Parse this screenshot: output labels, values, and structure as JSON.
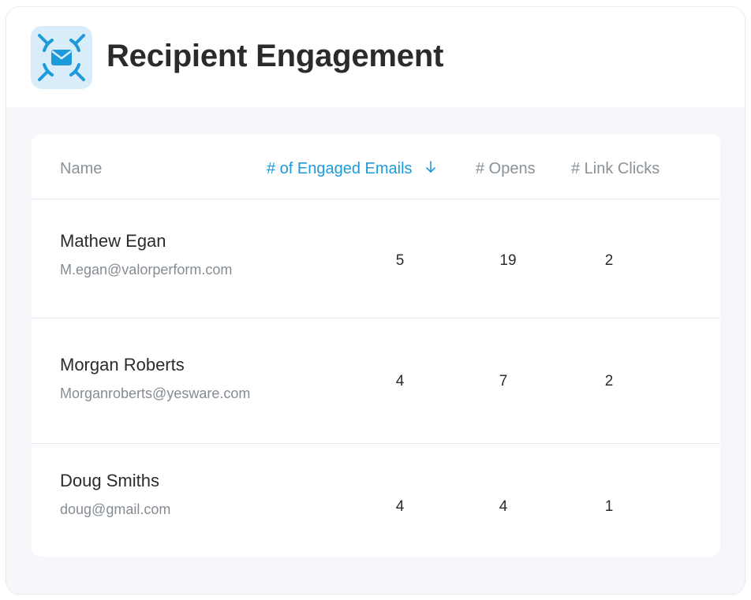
{
  "header": {
    "title": "Recipient Engagement",
    "logo_icon": "envelope-target-icon"
  },
  "table": {
    "columns": {
      "name": "Name",
      "engaged": "# of Engaged Emails",
      "opens": "# Opens",
      "clicks": "# Link Clicks"
    },
    "sort_icon": "arrow-down-icon",
    "rows": [
      {
        "name": "Mathew Egan",
        "email": "M.egan@valorperform.com",
        "engaged": "5",
        "opens": "19",
        "clicks": "2"
      },
      {
        "name": "Morgan Roberts",
        "email": "Morganroberts@yesware.com",
        "engaged": "4",
        "opens": "7",
        "clicks": "2"
      },
      {
        "name": "Doug Smiths",
        "email": "doug@gmail.com",
        "engaged": "4",
        "opens": "4",
        "clicks": "1"
      }
    ]
  },
  "colors": {
    "accent": "#1d9ad9",
    "logo_bg": "#d9ecfa",
    "panel_bg": "#f5f7fb"
  }
}
